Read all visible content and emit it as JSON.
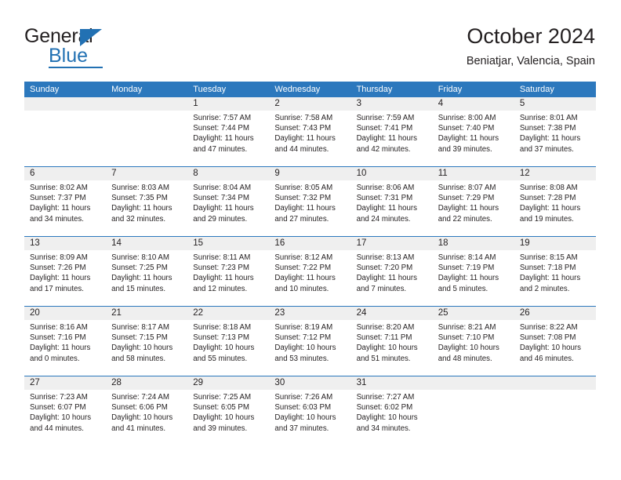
{
  "brand": {
    "name_top": "General",
    "name_bottom": "Blue",
    "accent_color": "#2271b3"
  },
  "header": {
    "title": "October 2024",
    "subtitle": "Beniatjar, Valencia, Spain"
  },
  "calendar": {
    "header_bg": "#2c78bd",
    "daynum_bg": "#efefef",
    "weekdays": [
      "Sunday",
      "Monday",
      "Tuesday",
      "Wednesday",
      "Thursday",
      "Friday",
      "Saturday"
    ],
    "weeks": [
      [
        {
          "day": "",
          "lines": []
        },
        {
          "day": "",
          "lines": []
        },
        {
          "day": "1",
          "lines": [
            "Sunrise: 7:57 AM",
            "Sunset: 7:44 PM",
            "Daylight: 11 hours",
            "and 47 minutes."
          ]
        },
        {
          "day": "2",
          "lines": [
            "Sunrise: 7:58 AM",
            "Sunset: 7:43 PM",
            "Daylight: 11 hours",
            "and 44 minutes."
          ]
        },
        {
          "day": "3",
          "lines": [
            "Sunrise: 7:59 AM",
            "Sunset: 7:41 PM",
            "Daylight: 11 hours",
            "and 42 minutes."
          ]
        },
        {
          "day": "4",
          "lines": [
            "Sunrise: 8:00 AM",
            "Sunset: 7:40 PM",
            "Daylight: 11 hours",
            "and 39 minutes."
          ]
        },
        {
          "day": "5",
          "lines": [
            "Sunrise: 8:01 AM",
            "Sunset: 7:38 PM",
            "Daylight: 11 hours",
            "and 37 minutes."
          ]
        }
      ],
      [
        {
          "day": "6",
          "lines": [
            "Sunrise: 8:02 AM",
            "Sunset: 7:37 PM",
            "Daylight: 11 hours",
            "and 34 minutes."
          ]
        },
        {
          "day": "7",
          "lines": [
            "Sunrise: 8:03 AM",
            "Sunset: 7:35 PM",
            "Daylight: 11 hours",
            "and 32 minutes."
          ]
        },
        {
          "day": "8",
          "lines": [
            "Sunrise: 8:04 AM",
            "Sunset: 7:34 PM",
            "Daylight: 11 hours",
            "and 29 minutes."
          ]
        },
        {
          "day": "9",
          "lines": [
            "Sunrise: 8:05 AM",
            "Sunset: 7:32 PM",
            "Daylight: 11 hours",
            "and 27 minutes."
          ]
        },
        {
          "day": "10",
          "lines": [
            "Sunrise: 8:06 AM",
            "Sunset: 7:31 PM",
            "Daylight: 11 hours",
            "and 24 minutes."
          ]
        },
        {
          "day": "11",
          "lines": [
            "Sunrise: 8:07 AM",
            "Sunset: 7:29 PM",
            "Daylight: 11 hours",
            "and 22 minutes."
          ]
        },
        {
          "day": "12",
          "lines": [
            "Sunrise: 8:08 AM",
            "Sunset: 7:28 PM",
            "Daylight: 11 hours",
            "and 19 minutes."
          ]
        }
      ],
      [
        {
          "day": "13",
          "lines": [
            "Sunrise: 8:09 AM",
            "Sunset: 7:26 PM",
            "Daylight: 11 hours",
            "and 17 minutes."
          ]
        },
        {
          "day": "14",
          "lines": [
            "Sunrise: 8:10 AM",
            "Sunset: 7:25 PM",
            "Daylight: 11 hours",
            "and 15 minutes."
          ]
        },
        {
          "day": "15",
          "lines": [
            "Sunrise: 8:11 AM",
            "Sunset: 7:23 PM",
            "Daylight: 11 hours",
            "and 12 minutes."
          ]
        },
        {
          "day": "16",
          "lines": [
            "Sunrise: 8:12 AM",
            "Sunset: 7:22 PM",
            "Daylight: 11 hours",
            "and 10 minutes."
          ]
        },
        {
          "day": "17",
          "lines": [
            "Sunrise: 8:13 AM",
            "Sunset: 7:20 PM",
            "Daylight: 11 hours",
            "and 7 minutes."
          ]
        },
        {
          "day": "18",
          "lines": [
            "Sunrise: 8:14 AM",
            "Sunset: 7:19 PM",
            "Daylight: 11 hours",
            "and 5 minutes."
          ]
        },
        {
          "day": "19",
          "lines": [
            "Sunrise: 8:15 AM",
            "Sunset: 7:18 PM",
            "Daylight: 11 hours",
            "and 2 minutes."
          ]
        }
      ],
      [
        {
          "day": "20",
          "lines": [
            "Sunrise: 8:16 AM",
            "Sunset: 7:16 PM",
            "Daylight: 11 hours",
            "and 0 minutes."
          ]
        },
        {
          "day": "21",
          "lines": [
            "Sunrise: 8:17 AM",
            "Sunset: 7:15 PM",
            "Daylight: 10 hours",
            "and 58 minutes."
          ]
        },
        {
          "day": "22",
          "lines": [
            "Sunrise: 8:18 AM",
            "Sunset: 7:13 PM",
            "Daylight: 10 hours",
            "and 55 minutes."
          ]
        },
        {
          "day": "23",
          "lines": [
            "Sunrise: 8:19 AM",
            "Sunset: 7:12 PM",
            "Daylight: 10 hours",
            "and 53 minutes."
          ]
        },
        {
          "day": "24",
          "lines": [
            "Sunrise: 8:20 AM",
            "Sunset: 7:11 PM",
            "Daylight: 10 hours",
            "and 51 minutes."
          ]
        },
        {
          "day": "25",
          "lines": [
            "Sunrise: 8:21 AM",
            "Sunset: 7:10 PM",
            "Daylight: 10 hours",
            "and 48 minutes."
          ]
        },
        {
          "day": "26",
          "lines": [
            "Sunrise: 8:22 AM",
            "Sunset: 7:08 PM",
            "Daylight: 10 hours",
            "and 46 minutes."
          ]
        }
      ],
      [
        {
          "day": "27",
          "lines": [
            "Sunrise: 7:23 AM",
            "Sunset: 6:07 PM",
            "Daylight: 10 hours",
            "and 44 minutes."
          ]
        },
        {
          "day": "28",
          "lines": [
            "Sunrise: 7:24 AM",
            "Sunset: 6:06 PM",
            "Daylight: 10 hours",
            "and 41 minutes."
          ]
        },
        {
          "day": "29",
          "lines": [
            "Sunrise: 7:25 AM",
            "Sunset: 6:05 PM",
            "Daylight: 10 hours",
            "and 39 minutes."
          ]
        },
        {
          "day": "30",
          "lines": [
            "Sunrise: 7:26 AM",
            "Sunset: 6:03 PM",
            "Daylight: 10 hours",
            "and 37 minutes."
          ]
        },
        {
          "day": "31",
          "lines": [
            "Sunrise: 7:27 AM",
            "Sunset: 6:02 PM",
            "Daylight: 10 hours",
            "and 34 minutes."
          ]
        },
        {
          "day": "",
          "lines": []
        },
        {
          "day": "",
          "lines": []
        }
      ]
    ]
  }
}
